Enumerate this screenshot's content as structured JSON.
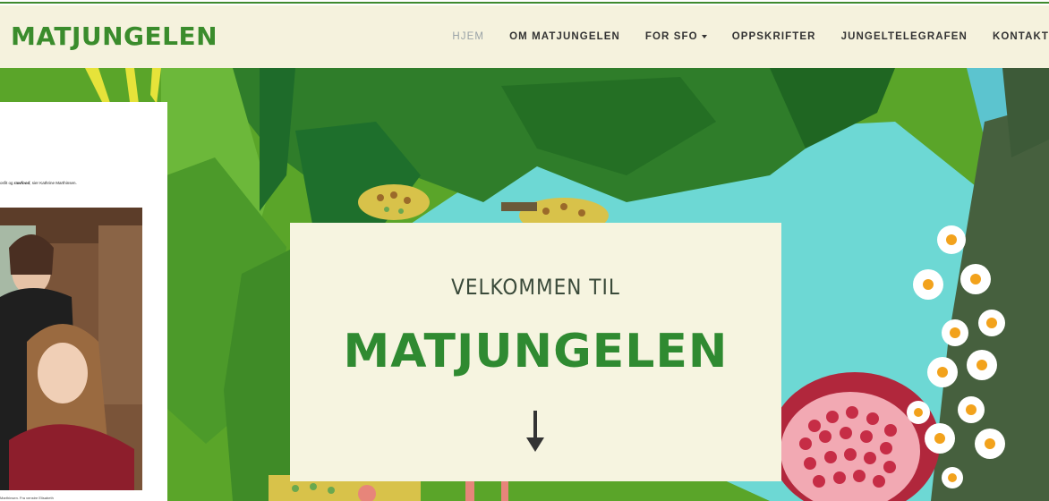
{
  "brand": {
    "logo_text": "MATJUNGELEN"
  },
  "nav": {
    "items": [
      {
        "label": "HJEM"
      },
      {
        "label": "OM MATJUNGELEN"
      },
      {
        "label": "FOR SFO"
      },
      {
        "label": "OPPSKRIFTER"
      },
      {
        "label": "JUNGELTELEGRAFEN"
      },
      {
        "label": "KONTAKT"
      }
    ]
  },
  "hero": {
    "welcome_title": "VELKOMMEN TIL",
    "welcome_logo": "MATJUNGELEN",
    "arrow_icon": "arrow-down-icon"
  },
  "article": {
    "line_prefix": "osfit og ",
    "line_italic": "rawfood",
    "line_suffix": ", sier Kathrine Marthinsen.",
    "caption": "Marthinsen. Fra venstre Elisabeth"
  },
  "colors": {
    "navbar_bg": "#f5f2dd",
    "brand_green": "#3a8c2c",
    "welcome_bg": "#f6f4e0",
    "sky": "#6dd8d4"
  }
}
